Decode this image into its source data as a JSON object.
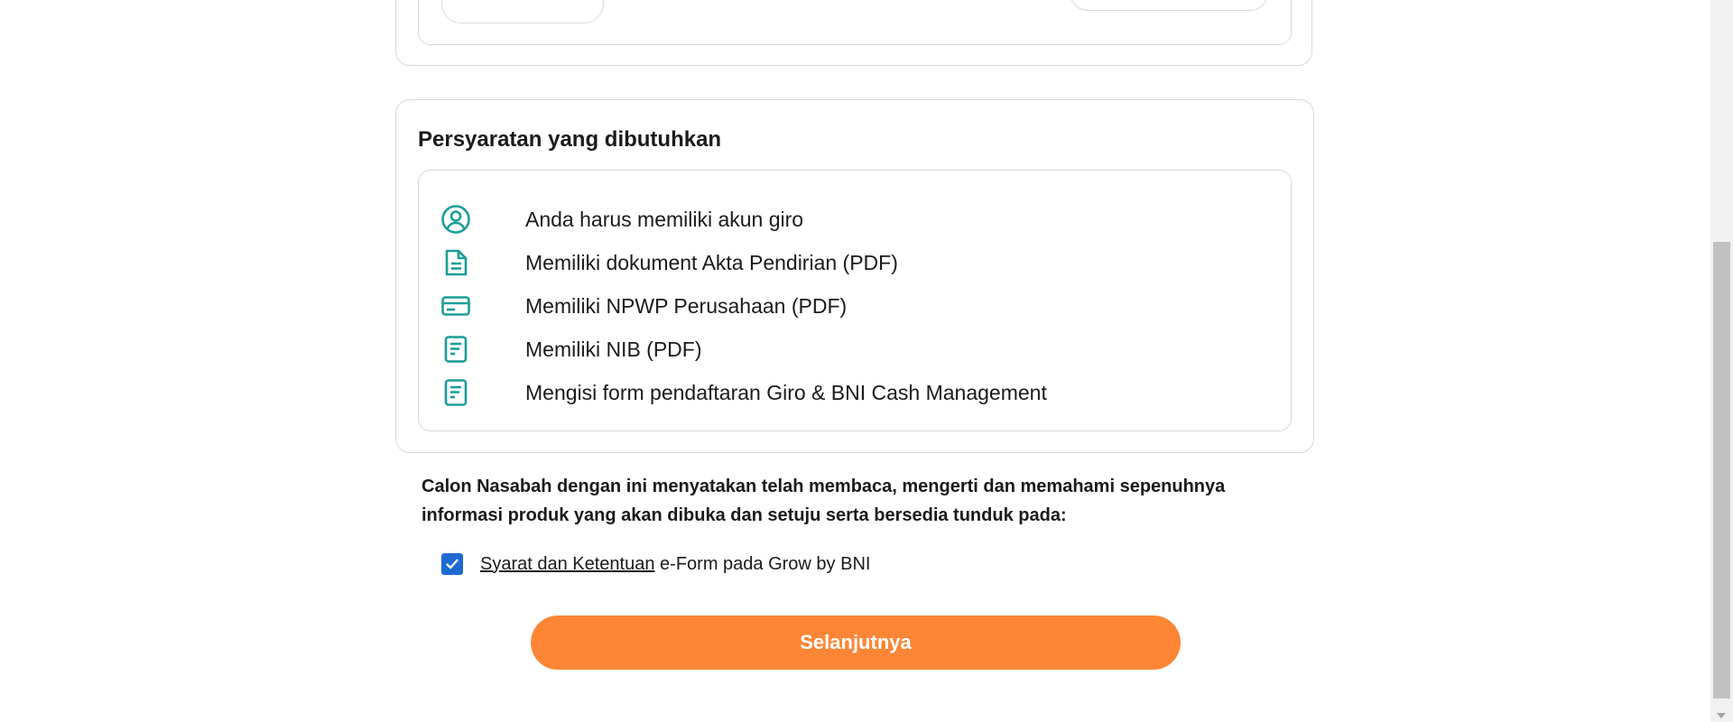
{
  "requirements": {
    "title": "Persyaratan yang dibutuhkan",
    "items": [
      {
        "icon": "user-circle-icon",
        "text": "Anda harus memiliki akun giro"
      },
      {
        "icon": "document-icon",
        "text": "Memiliki dokument Akta Pendirian (PDF)"
      },
      {
        "icon": "card-icon",
        "text": "Memiliki NPWP Perusahaan (PDF)"
      },
      {
        "icon": "form-icon",
        "text": "Memiliki NIB (PDF)"
      },
      {
        "icon": "form-icon",
        "text": "Mengisi form pendaftaran Giro & BNI Cash Management"
      }
    ]
  },
  "declaration": {
    "text": "Calon Nasabah dengan ini menyatakan telah membaca, mengerti dan memahami sepenuhnya informasi produk yang akan dibuka dan setuju serta bersedia tunduk pada:"
  },
  "agreement": {
    "checked": true,
    "link_text": "Syarat dan Ketentuan",
    "suffix_text": " e-Form pada Grow by BNI"
  },
  "actions": {
    "next_label": "Selanjutnya"
  },
  "colors": {
    "accent_teal": "#1a9e96",
    "button_orange": "#fd8636",
    "checkbox_blue": "#1e6ad2",
    "border": "#d9d9d9"
  }
}
